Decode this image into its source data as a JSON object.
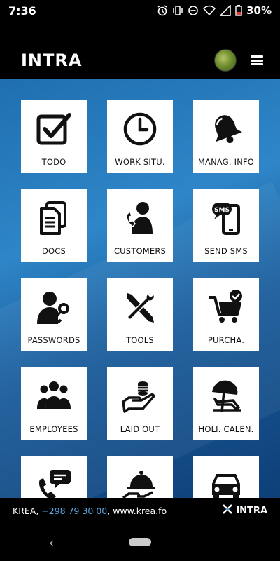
{
  "status_bar": {
    "time": "7:36",
    "battery": "30%",
    "icons": [
      "alarm-icon",
      "vibrate-icon",
      "dnd-icon",
      "wifi-icon",
      "signal-icon",
      "battery-icon"
    ]
  },
  "header": {
    "title": "INTRA",
    "avatar": "user-avatar",
    "menu_icon": "hamburger-menu-icon"
  },
  "tiles": [
    {
      "label": "TODO",
      "icon": "checkbox-icon"
    },
    {
      "label": "WORK SITU.",
      "icon": "clock-icon"
    },
    {
      "label": "MANAG. INFO",
      "icon": "bell-icon"
    },
    {
      "label": "DOCS",
      "icon": "documents-icon"
    },
    {
      "label": "CUSTOMERS",
      "icon": "customer-phone-icon"
    },
    {
      "label": "SEND SMS",
      "icon": "sms-phone-icon"
    },
    {
      "label": "PASSWORDS",
      "icon": "user-key-icon"
    },
    {
      "label": "TOOLS",
      "icon": "tools-icon"
    },
    {
      "label": "PURCHA.",
      "icon": "cart-check-icon"
    },
    {
      "label": "EMPLOYEES",
      "icon": "group-icon"
    },
    {
      "label": "LAID OUT",
      "icon": "coins-hand-icon"
    },
    {
      "label": "HOLI. CALEN.",
      "icon": "beach-umbrella-icon"
    },
    {
      "label": "",
      "icon": "phone-chat-icon"
    },
    {
      "label": "",
      "icon": "food-cloche-icon"
    },
    {
      "label": "",
      "icon": "car-icon"
    }
  ],
  "footer": {
    "company": "KREA, ",
    "phone": "+298 79 30 00",
    "website": ", www.krea.fo",
    "brand": "INTRA"
  },
  "colors": {
    "background_blue": "#2e86c8",
    "link": "#5aa9e6",
    "tile": "#ffffff"
  }
}
